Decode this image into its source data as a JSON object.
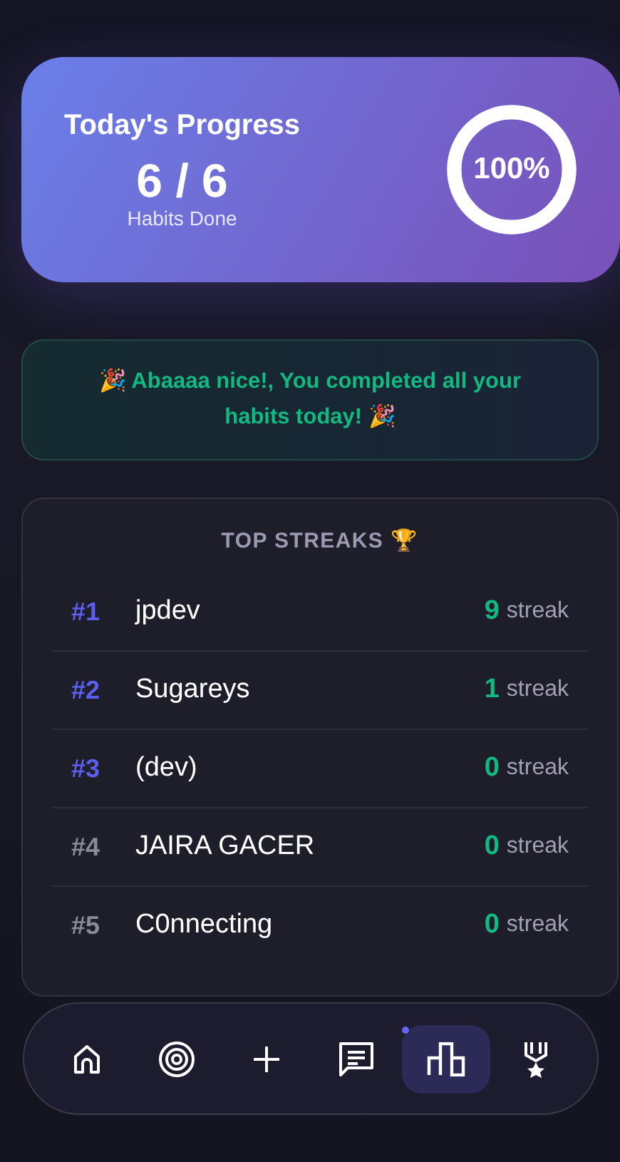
{
  "progress": {
    "title": "Today's Progress",
    "count": "6 / 6",
    "caption": "Habits Done",
    "percent": "100%",
    "level": 1
  },
  "banner": {
    "text": "🎉 Abaaaa nice!, You completed all your habits today! 🎉"
  },
  "streaks": {
    "title": "TOP STREAKS 🏆",
    "rows": [
      {
        "rank": "#1",
        "name": "jpdev",
        "value": "9",
        "unit": "streak",
        "color": "#5b5ff0"
      },
      {
        "rank": "#2",
        "name": "Sugareys",
        "value": "1",
        "unit": "streak",
        "color": "#5b5ff0"
      },
      {
        "rank": "#3",
        "name": "(dev)",
        "value": "0",
        "unit": "streak",
        "color": "#5b5ff0"
      },
      {
        "rank": "#4",
        "name": "JAIRA GACER",
        "value": "0",
        "unit": "streak",
        "color": "#8a8a98"
      },
      {
        "rank": "#5",
        "name": "C0nnecting",
        "value": "0",
        "unit": "streak",
        "color": "#8a8a98"
      }
    ]
  },
  "nav": [
    {
      "kind": "home",
      "selected": false
    },
    {
      "kind": "target",
      "selected": false
    },
    {
      "kind": "add",
      "selected": false
    },
    {
      "kind": "chat",
      "selected": false
    },
    {
      "kind": "chart",
      "selected": true
    },
    {
      "kind": "medal",
      "selected": false
    }
  ]
}
